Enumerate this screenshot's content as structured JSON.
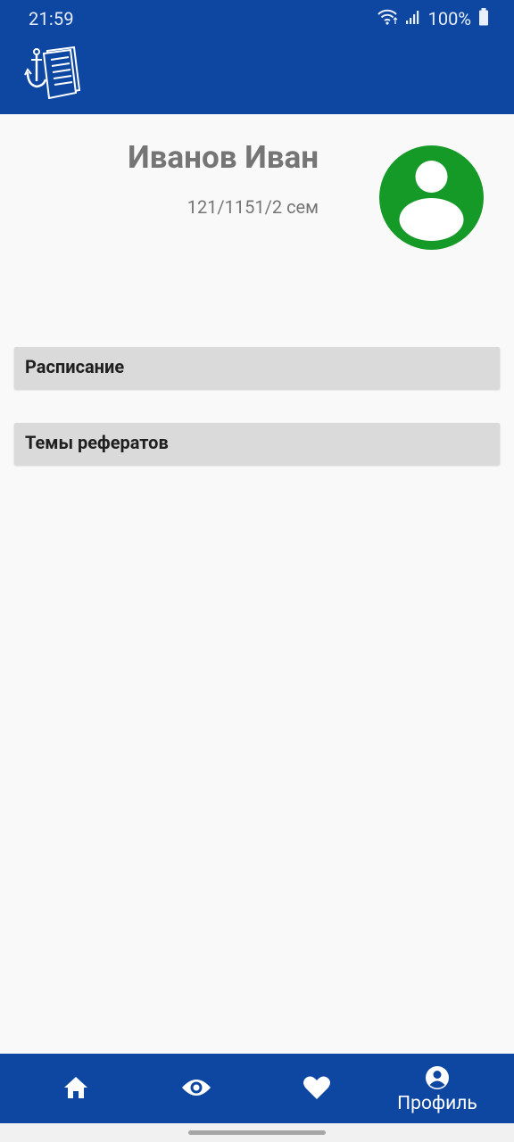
{
  "status_bar": {
    "time": "21:59",
    "battery": "100%",
    "icons": [
      "wifi-icon",
      "signal-icon",
      "battery-icon"
    ]
  },
  "app_bar": {
    "logo_icon": "book-anchor-logo"
  },
  "profile": {
    "name": "Иванов Иван",
    "group": "121/1151/2 сем",
    "avatar_icon": "user-avatar-icon",
    "avatar_color": "#159a27"
  },
  "menu": {
    "items": [
      {
        "label": "Расписание"
      },
      {
        "label": "Темы рефератов"
      }
    ]
  },
  "bottom_nav": {
    "items": [
      {
        "icon": "home-icon",
        "label": ""
      },
      {
        "icon": "eye-icon",
        "label": ""
      },
      {
        "icon": "heart-icon",
        "label": ""
      },
      {
        "icon": "account-icon",
        "label": "Профиль",
        "active": true
      }
    ]
  },
  "colors": {
    "primary": "#0d47a1",
    "background": "#f9f9f9",
    "card": "#d9dad9",
    "muted_text": "#757575"
  }
}
